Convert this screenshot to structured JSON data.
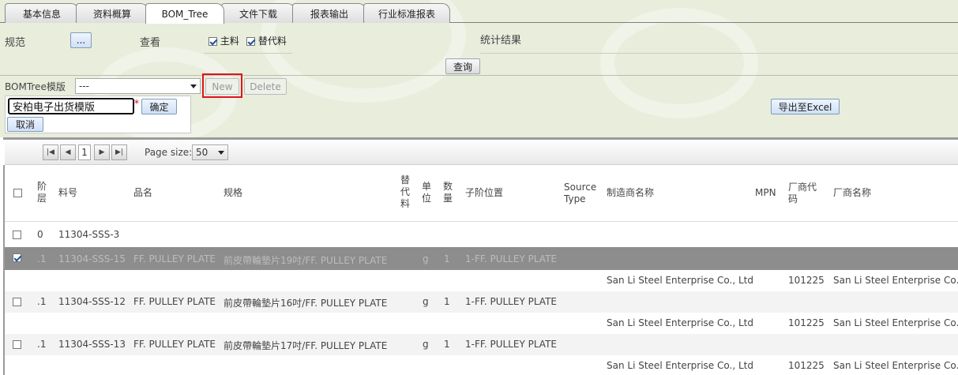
{
  "tabs": [
    "基本信息",
    "资料概算",
    "BOM_Tree",
    "文件下载",
    "报表输出",
    "行业标准报表"
  ],
  "filters": {
    "spec_label": "规范",
    "browse_label": "...",
    "view_label": "查看",
    "main_material_label": "主料",
    "substitute_label": "替代料",
    "stats_label": "统计结果",
    "query_label": "查询"
  },
  "template": {
    "label": "BOMTree模版",
    "selected": "---",
    "new_label": "New",
    "delete_label": "Delete",
    "name_value": "安柏电子出货模版",
    "required_mark": "*",
    "confirm_label": "确定",
    "cancel_label": "取消",
    "export_label": "导出至Excel"
  },
  "pager": {
    "current_page": "1",
    "page_size_label": "Page size:",
    "page_size": "50"
  },
  "columns": {
    "level": "阶层",
    "part_no": "料号",
    "name": "品名",
    "spec": "规格",
    "substitute": "替代料",
    "unit": "单位",
    "qty": "数量",
    "sub_position": "子阶位置",
    "source_type": "Source Type",
    "manufacturer": "制造商名称",
    "mpn": "MPN",
    "vendor_code": "厂商代码",
    "vendor_name": "厂商名称"
  },
  "rows": [
    {
      "checked": false,
      "level": "0",
      "part_no": "11304-SSS-3",
      "name": "",
      "spec": "",
      "unit": "",
      "qty": "",
      "sub_position": ""
    },
    {
      "checked": true,
      "level": ".1",
      "part_no": "11304-SSS-15",
      "name": "FF. PULLEY PLATE",
      "spec": "前皮帶輪墊片19吋/FF. PULLEY PLATE",
      "unit": "g",
      "qty": "1",
      "sub_position": "1-FF. PULLEY PLATE"
    },
    {
      "manufacturer": "San Li Steel Enterprise Co., Ltd",
      "vendor_code": "101225",
      "vendor_name": "San Li Steel Enterprise Co., L"
    },
    {
      "checked": false,
      "level": ".1",
      "part_no": "11304-SSS-12",
      "name": "FF. PULLEY PLATE",
      "spec": "前皮帶輪墊片16吋/FF. PULLEY PLATE",
      "unit": "g",
      "qty": "1",
      "sub_position": "1-FF. PULLEY PLATE"
    },
    {
      "manufacturer": "San Li Steel Enterprise Co., Ltd",
      "vendor_code": "101225",
      "vendor_name": "San Li Steel Enterprise Co., L"
    },
    {
      "checked": false,
      "level": ".1",
      "part_no": "11304-SSS-13",
      "name": "FF. PULLEY PLATE",
      "spec": "前皮帶輪墊片17吋/FF. PULLEY PLATE",
      "unit": "g",
      "qty": "1",
      "sub_position": "1-FF. PULLEY PLATE"
    },
    {
      "manufacturer": "San Li Steel Enterprise Co., Ltd",
      "vendor_code": "101225",
      "vendor_name": "San Li Steel Enterprise Co., L"
    }
  ],
  "colors": {
    "background_top": "#e8eddc",
    "selected_row": "#8d8d8d",
    "highlight_outline": "#e0141e"
  }
}
